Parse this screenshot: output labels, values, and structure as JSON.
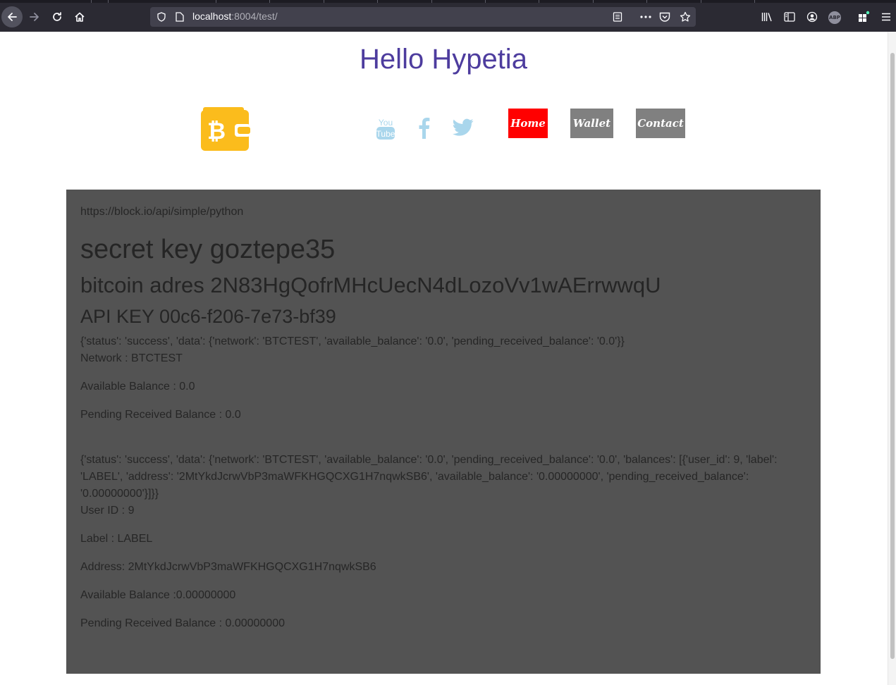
{
  "browser": {
    "url_host": "localhost",
    "url_rest": ":8004/test/"
  },
  "page": {
    "title": "Hello Hypetia",
    "nav": {
      "home": "Home",
      "wallet": "Wallet",
      "contact": "Contact"
    },
    "social": [
      "youtube-icon",
      "facebook-icon",
      "twitter-icon"
    ],
    "colors": {
      "title": "#4d3c9e",
      "panel_bg": "#535353",
      "home_btn": "#ff0000",
      "nav_btn": "#808080",
      "wallet_logo": "#fbbc1c",
      "social_icons": "#a9d6ec"
    }
  },
  "content": {
    "api_url": "https://block.io/api/simple/python",
    "secret_key": "secret key goztepe35",
    "bitcoin_address": "bitcoin adres 2N83HgQofrMHcUecN4dLozoVv1wAErrwwqU",
    "api_key": "API KEY 00c6-f206-7e73-bf39",
    "balance_response": "{'status': 'success', 'data': {'network': 'BTCTEST', 'available_balance': '0.0', 'pending_received_balance': '0.0'}}",
    "network": "Network : BTCTEST",
    "available_balance": "Available Balance : 0.0",
    "pending_received_balance": "Pending Received Balance : 0.0",
    "addresses_response": "{'status': 'success', 'data': {'network': 'BTCTEST', 'available_balance': '0.0', 'pending_received_balance': '0.0', 'balances': [{'user_id': 9, 'label': 'LABEL', 'address': '2MtYkdJcrwVbP3maWFKHGQCXG1H7nqwkSB6', 'available_balance': '0.00000000', 'pending_received_balance': '0.00000000'}]}}",
    "user_id": "User ID : 9",
    "label": "Label : LABEL",
    "address": "Address: 2MtYkdJcrwVbP3maWFKHGQCXG1H7nqwkSB6",
    "user_available_balance": "Available Balance :0.00000000",
    "user_pending_balance": "Pending Received Balance : 0.00000000"
  }
}
